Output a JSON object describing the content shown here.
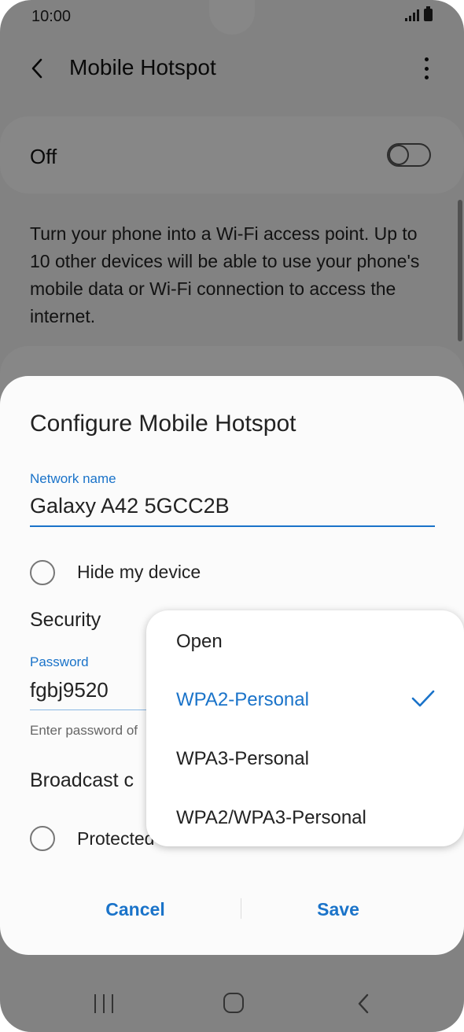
{
  "status_bar": {
    "time": "10:00",
    "signal_icon": "signal-icon",
    "battery_icon": "battery-icon"
  },
  "header": {
    "back_icon": "chevron-left-icon",
    "title": "Mobile Hotspot",
    "more_icon": "more-vertical-icon"
  },
  "hotspot_toggle": {
    "label": "Off",
    "state": "off"
  },
  "description": "Turn your phone into a Wi-Fi access point. Up to 10 other devices will be able to use your phone's mobile data or Wi-Fi connection to access the internet.",
  "dialog": {
    "title": "Configure Mobile Hotspot",
    "network_name_label": "Network name",
    "network_name_value": "Galaxy A42 5GCC2B",
    "hide_device_label": "Hide my device",
    "security_label": "Security",
    "password_label": "Password",
    "password_value": "fgbj9520",
    "password_hint": "Enter password of",
    "broadcast_label": "Broadcast c",
    "pmf_label": "Protected",
    "cancel_label": "Cancel",
    "save_label": "Save"
  },
  "security_dropdown": {
    "options": [
      "Open",
      "WPA2-Personal",
      "WPA3-Personal",
      "WPA2/WPA3-Personal"
    ],
    "selected": "WPA2-Personal"
  },
  "nav_bar": {
    "recents_icon": "recents-icon",
    "home_icon": "home-icon",
    "back_icon": "back-icon"
  },
  "colors": {
    "accent": "#1a73c9",
    "dim_overlay": "#000000"
  }
}
